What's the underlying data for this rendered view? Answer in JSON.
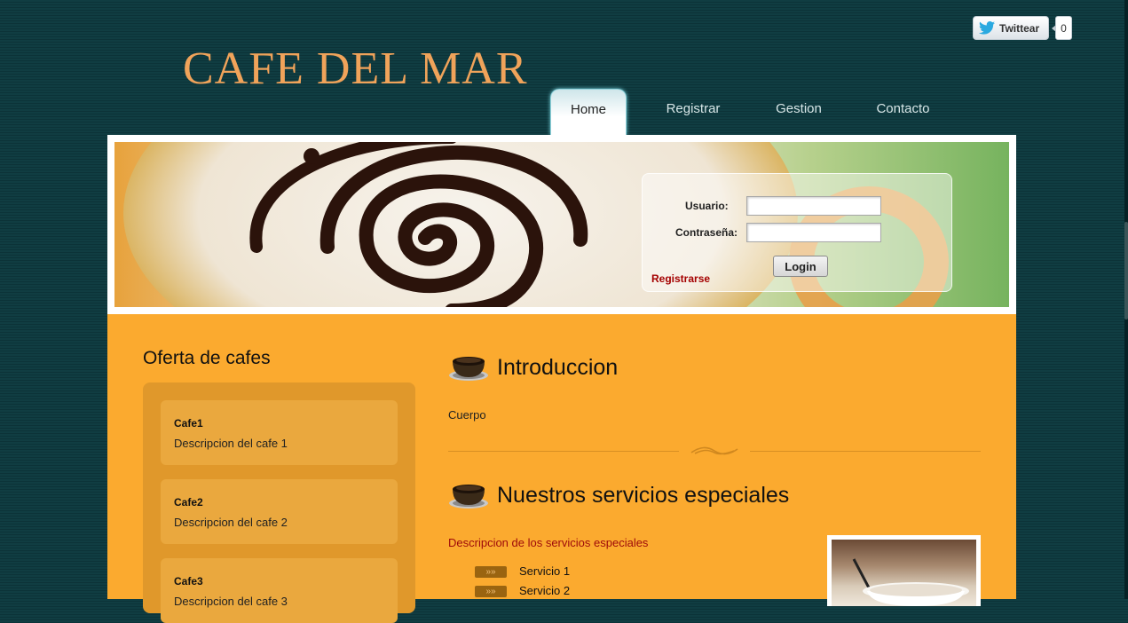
{
  "header": {
    "logo_text": "CAFE DEL MAR",
    "twitter": {
      "label": "Twittear",
      "count": "0"
    }
  },
  "nav": {
    "items": [
      {
        "label": "Home",
        "active": true
      },
      {
        "label": "Registrar",
        "active": false
      },
      {
        "label": "Gestion",
        "active": false
      },
      {
        "label": "Contacto",
        "active": false
      }
    ]
  },
  "login": {
    "user_label": "Usuario:",
    "user_value": "",
    "password_label": "Contraseña:",
    "password_value": "",
    "button_label": "Login",
    "register_link": "Registrarse"
  },
  "sidebar": {
    "title": "Oferta de cafes",
    "cafes": [
      {
        "name": "Cafe1",
        "description": "Descripcion del cafe 1"
      },
      {
        "name": "Cafe2",
        "description": "Descripcion del cafe 2"
      },
      {
        "name": "Cafe3",
        "description": "Descripcion del cafe 3"
      }
    ]
  },
  "main": {
    "intro": {
      "title": "Introduccion",
      "body": "Cuerpo"
    },
    "services": {
      "title": "Nuestros servicios especiales",
      "description": "Descripcion de los servicios especiales",
      "items": [
        "Servicio 1",
        "Servicio 2"
      ],
      "bullet_glyph": "»»"
    }
  },
  "colors": {
    "page_background": "#0c3338",
    "logo": "#f0a35a",
    "content_background": "#fbaa2f",
    "link_red": "#a40000"
  },
  "icons": [
    "twitter-bird-icon",
    "coffee-cup-icon",
    "double-chevron-icon"
  ]
}
